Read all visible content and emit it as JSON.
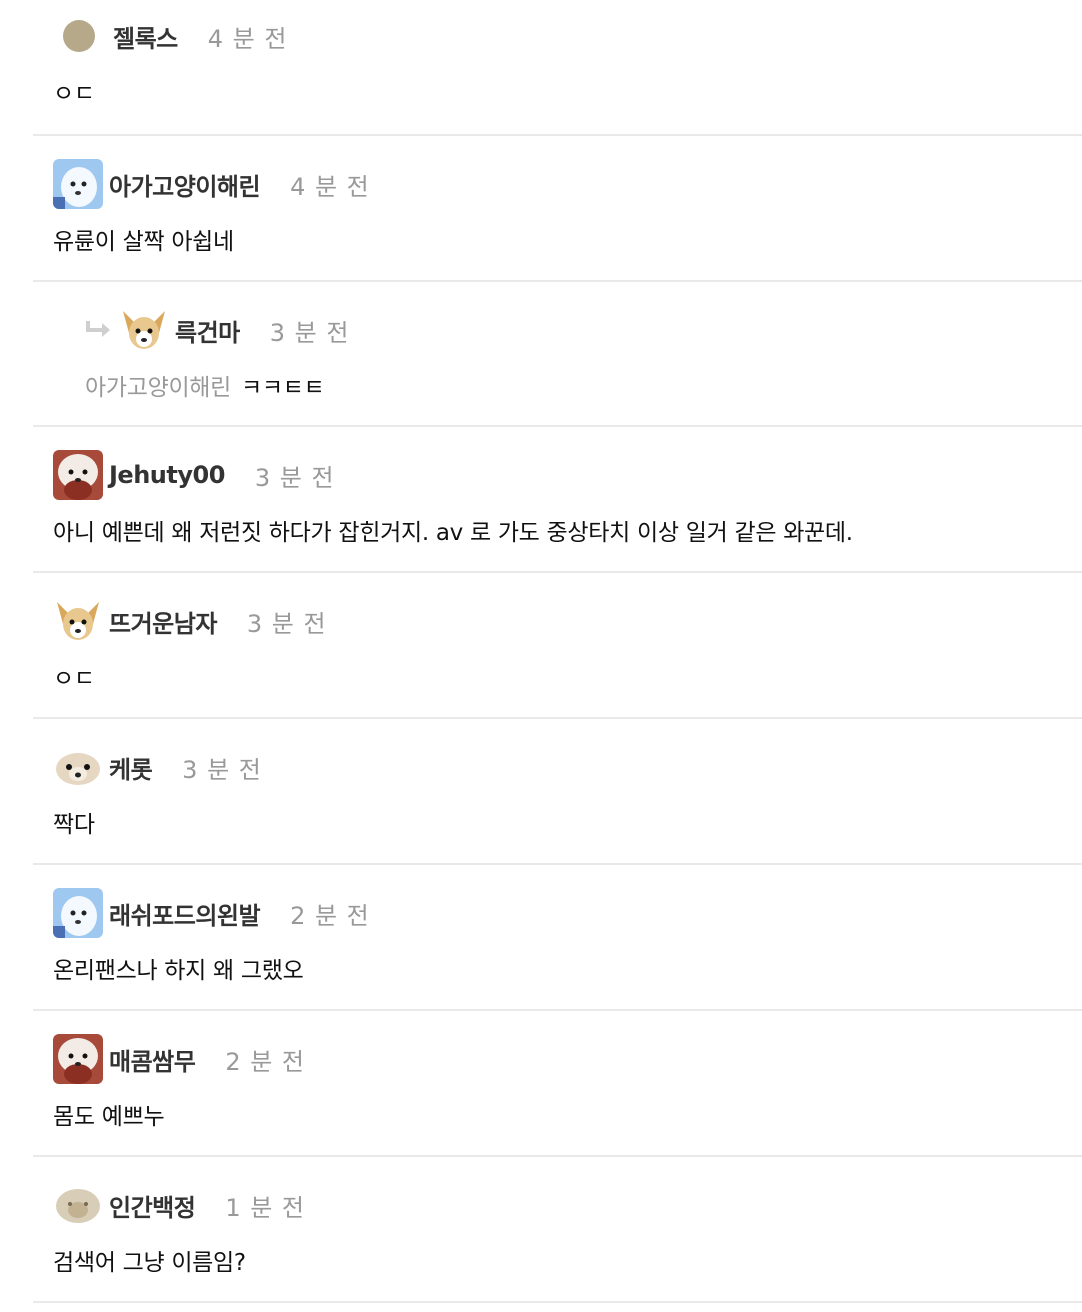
{
  "comments": [
    {
      "name": "젤록스",
      "time": "4 분 전",
      "text": "ㅇㄷ",
      "avatar": "gray-circle-avatar"
    },
    {
      "name": "아가고양이해린",
      "time": "4 분 전",
      "text": "유륜이 살짝 아쉽네",
      "avatar": "white-dog-avatar"
    },
    {
      "name": "륵건마",
      "time": "3 분 전",
      "mention": "아가고양이해린",
      "text": "ㅋㅋㅌㅌ",
      "avatar": "chihuahua-avatar",
      "reply": true
    },
    {
      "name": "Jehuty00",
      "time": "3 분 전",
      "text": "아니 예쁜데 왜 저런짓 하다가 잡힌거지. av 로 가도 중상타치 이상 일거 같은 와꾼데.",
      "avatar": "maltese-avatar"
    },
    {
      "name": "뜨거운남자",
      "time": "3 분 전",
      "text": "ㅇㄷ",
      "avatar": "chihuahua-avatar"
    },
    {
      "name": "케롯",
      "time": "3 분 전",
      "text": "짝다",
      "avatar": "pug-avatar"
    },
    {
      "name": "래쉬포드의왼발",
      "time": "2 분 전",
      "text": "온리팬스나 하지 왜 그랬오",
      "avatar": "white-dog-avatar"
    },
    {
      "name": "매콤쌈무",
      "time": "2 분 전",
      "text": "몸도 예쁘누",
      "avatar": "maltese-avatar"
    },
    {
      "name": "인간백정",
      "time": "1 분 전",
      "text": "검색어 그냥 이름임?",
      "avatar": "blur-dog-avatar"
    }
  ]
}
